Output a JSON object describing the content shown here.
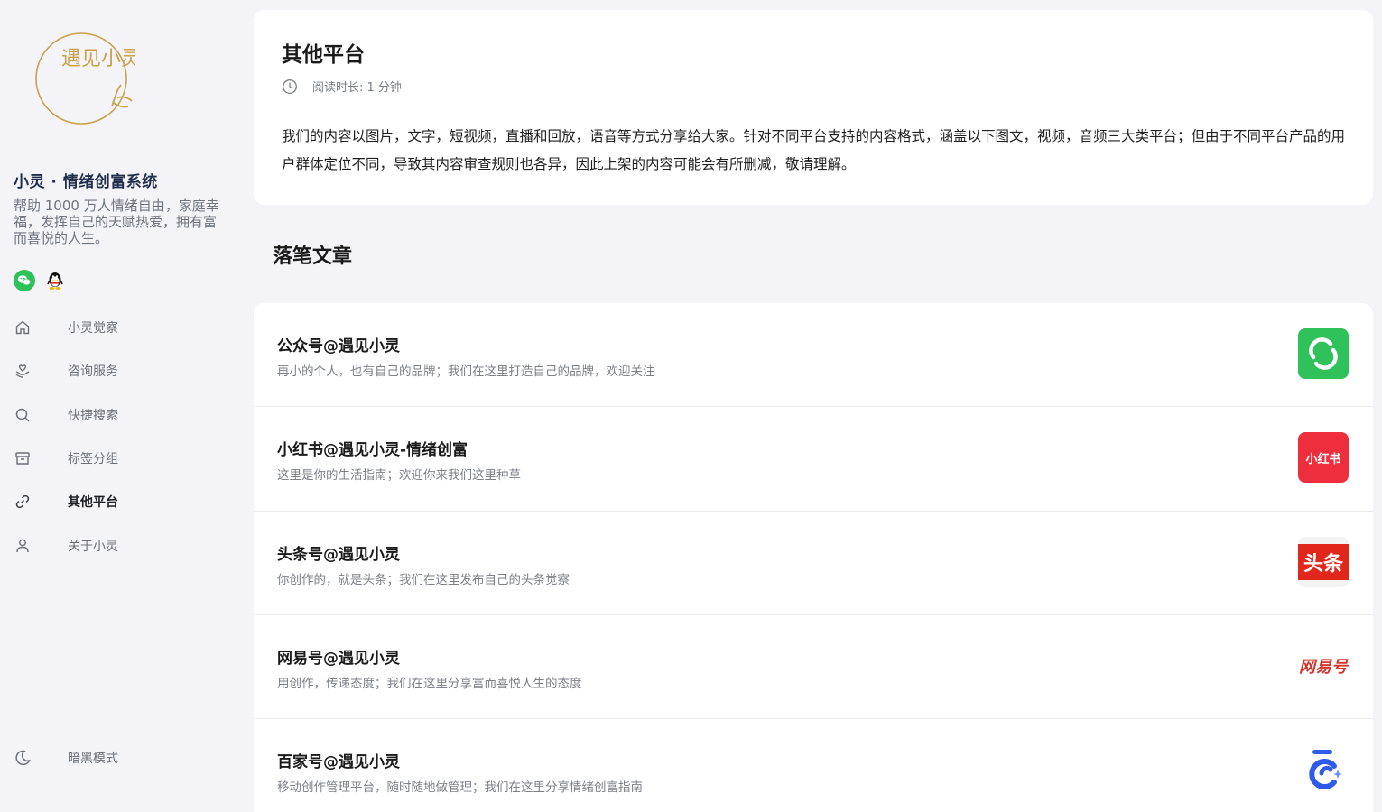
{
  "sidebar": {
    "logo_text": "遇见小灵",
    "site_title": "小灵 · 情绪创富系统",
    "site_desc": "帮助 1000 万人情绪自由，家庭幸福，发挥自己的天赋热爱，拥有富而喜悦的人生。",
    "social": [
      {
        "icon": "wechat-icon"
      },
      {
        "icon": "qq-icon"
      }
    ],
    "nav": [
      {
        "label": "小灵觉察",
        "icon": "home-icon"
      },
      {
        "label": "咨询服务",
        "icon": "heart-hand-icon"
      },
      {
        "label": "快捷搜索",
        "icon": "search-icon"
      },
      {
        "label": "标签分组",
        "icon": "archive-icon"
      },
      {
        "label": "其他平台",
        "icon": "link-icon",
        "active": true
      },
      {
        "label": "关于小灵",
        "icon": "user-icon"
      }
    ],
    "dark_mode_label": "暗黑模式"
  },
  "header": {
    "title": "其他平台",
    "read_time": "阅读时长: 1 分钟",
    "intro": "我们的内容以图片，文字，短视频，直播和回放，语音等方式分享给大家。针对不同平台支持的内容格式，涵盖以下图文，视频，音频三大类平台；但由于不同平台产品的用户群体定位不同，导致其内容审查规则也各异，因此上架的内容可能会有所删减，敬请理解。"
  },
  "section_title": "落笔文章",
  "platforms": [
    {
      "title": "公众号@遇见小灵",
      "desc": "再小的个人，也有自己的品牌；我们在这里打造自己的品牌，欢迎关注",
      "logo": "wechat-official-logo",
      "color": "#2fc25b"
    },
    {
      "title": "小红书@遇见小灵-情绪创富",
      "desc": "这里是你的生活指南；欢迎你来我们这里种草",
      "logo": "xiaohongshu-logo",
      "logo_text": "小红书",
      "color": "#ee2e3c"
    },
    {
      "title": "头条号@遇见小灵",
      "desc": "你创作的，就是头条；我们在这里发布自己的头条觉察",
      "logo": "toutiao-logo",
      "logo_text": "头条",
      "color": "#e1261c"
    },
    {
      "title": "网易号@遇见小灵",
      "desc": "用创作，传递态度；我们在这里分享富而喜悦人生的态度",
      "logo": "netease-logo",
      "logo_text": "网易号",
      "color": "#d4362c"
    },
    {
      "title": "百家号@遇见小灵",
      "desc": "移动创作管理平台，随时随地做管理；我们在这里分享情绪创富指南",
      "logo": "baijiahao-logo",
      "color": "#2f5bea"
    }
  ]
}
